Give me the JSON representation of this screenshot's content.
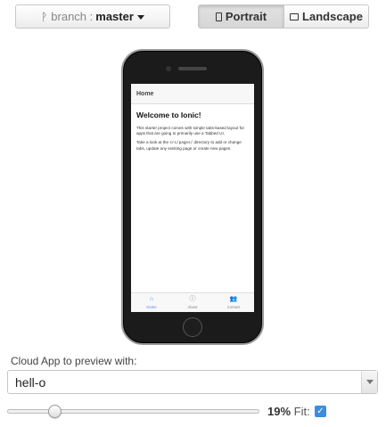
{
  "toolbar": {
    "branch_label": "branch :",
    "branch_value": "master",
    "orientation": {
      "portrait_label": "Portrait",
      "landscape_label": "Landscape",
      "selected": "Portrait"
    }
  },
  "phone_app": {
    "header_title": "Home",
    "content_title": "Welcome to Ionic!",
    "paragraph1": "This starter project comes with simple tabs-based layout for apps that are going to primarily use a Tabbed UI.",
    "paragraph2_before": "Take a look at the ",
    "paragraph2_code": "src/pages/",
    "paragraph2_after": " directory to add or change tabs, update any existing page or create new pages.",
    "tabs": [
      {
        "label": "Home",
        "icon": "home-icon",
        "active": true
      },
      {
        "label": "About",
        "icon": "info-icon",
        "active": false
      },
      {
        "label": "Contact",
        "icon": "contacts-icon",
        "active": false
      }
    ],
    "accent_color": "#488aff"
  },
  "cloud_app": {
    "label": "Cloud App to preview with:",
    "selected": "hell-o"
  },
  "zoom": {
    "percent_text": "19%",
    "value_fraction": 0.19,
    "fit_label": "Fit:",
    "fit_checked": true
  }
}
